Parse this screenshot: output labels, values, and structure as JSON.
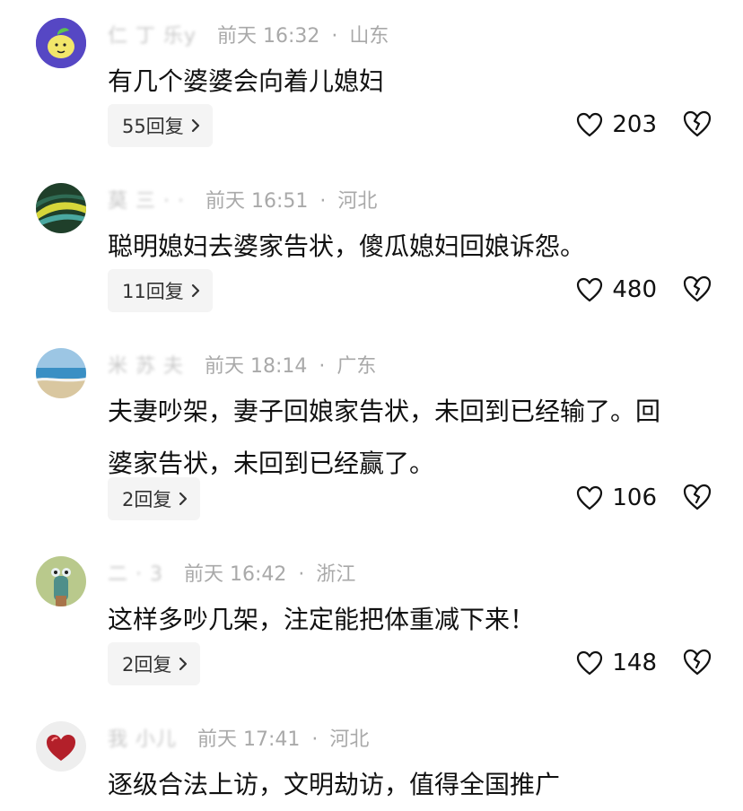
{
  "comments": [
    {
      "name": "仁 丁 乐y",
      "time": "前天 16:32",
      "location": "山东",
      "text": "有几个婆婆会向着儿媳妇",
      "replies": "55回复",
      "likes": "203",
      "avatar": "lemon"
    },
    {
      "name": "莫 三 · ·",
      "time": "前天 16:51",
      "location": "河北",
      "text": "聪明媳妇去婆家告状，傻瓜媳妇回娘诉怨。",
      "replies": "11回复",
      "likes": "480",
      "avatar": "leaf"
    },
    {
      "name": "米 苏 夫",
      "time": "前天 18:14",
      "location": "广东",
      "text": "夫妻吵架，妻子回娘家告状，未回到已经输了。回婆家告状，未回到已经赢了。",
      "replies": "2回复",
      "likes": "106",
      "avatar": "beach"
    },
    {
      "name": "二 · 3",
      "time": "前天 16:42",
      "location": "浙江",
      "text": "这样多吵几架，注定能把体重减下来！",
      "replies": "2回复",
      "likes": "148",
      "avatar": "cactus"
    },
    {
      "name": "我 小儿",
      "time": "前天 17:41",
      "location": "河北",
      "text": "逐级合法上访，文明劫访，值得全国推广",
      "replies": "",
      "likes": "",
      "avatar": "heart"
    }
  ],
  "icons": {
    "like": "heart-outline-icon",
    "dislike": "broken-heart-icon",
    "reply_chevron": "chevron-right-icon"
  },
  "colors": {
    "meta": "#a9a9a9",
    "text": "#111111",
    "reply_bg": "#f4f4f4"
  }
}
